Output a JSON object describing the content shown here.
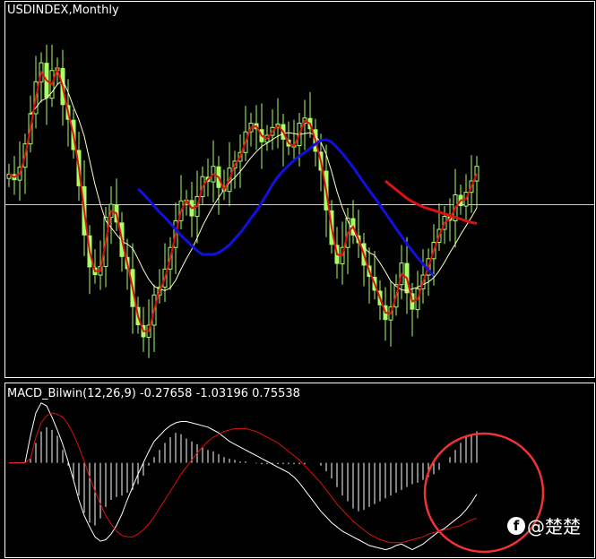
{
  "main_panel": {
    "title": "USDINDEX,Monthly"
  },
  "macd_panel": {
    "title": "MACD_Bilwin(12,26,9) -0.27658 -1.03196 0.75538"
  },
  "watermark": {
    "icon": "facebook-icon",
    "text": "@楚楚"
  },
  "colors": {
    "background": "#000000",
    "frame": "#ffffff",
    "candle": "#aaff66",
    "fast_ma": "#dd1111",
    "slow_ma": "#1111dd",
    "thin_ma": "#ffffcc",
    "macd_line": "#ffffff",
    "signal_line": "#dd1111",
    "annotation_circle": "#ee3333"
  },
  "chart_data": [
    {
      "type": "candlestick",
      "panel": "price",
      "title": "USDINDEX,Monthly",
      "x": [
        0,
        1,
        2,
        3,
        4,
        5,
        6,
        7,
        8,
        9,
        10,
        11,
        12,
        13,
        14,
        15,
        16,
        17,
        18,
        19,
        20,
        21,
        22,
        23,
        24,
        25,
        26,
        27,
        28,
        29,
        30,
        31,
        32,
        33,
        34,
        35,
        36,
        37,
        38,
        39,
        40,
        41,
        42,
        43,
        44,
        45,
        46,
        47,
        48,
        49,
        50,
        51,
        52,
        53,
        54,
        55,
        56,
        57,
        58,
        59,
        60,
        61,
        62,
        63,
        64,
        65,
        66,
        67,
        68,
        69,
        70,
        71,
        72,
        73,
        74,
        75,
        76,
        77,
        78,
        79,
        80,
        81,
        82,
        83,
        84,
        85,
        86,
        87
      ],
      "close": [
        97.9,
        97.2,
        98.7,
        101.4,
        104.9,
        108.6,
        110.8,
        106.7,
        109.9,
        110.2,
        105.9,
        104.2,
        100.7,
        96.5,
        90.8,
        87.1,
        86.2,
        87.2,
        92.9,
        94.4,
        92.3,
        88.3,
        86.9,
        82.5,
        80.4,
        79.0,
        80.4,
        83.9,
        84.8,
        86.9,
        89.4,
        92.5,
        94.8,
        94.9,
        93.0,
        95.3,
        97.6,
        97.0,
        98.8,
        96.3,
        95.9,
        98.6,
        99.4,
        100.4,
        102.8,
        103.8,
        103.1,
        101.6,
        102.4,
        103.3,
        103.7,
        101.9,
        101.1,
        101.2,
        103.8,
        104.4,
        103.1,
        100.5,
        98.3,
        93.7,
        89.7,
        87.5,
        89.4,
        92.8,
        90.8,
        89.9,
        87.3,
        86.0,
        84.4,
        82.7,
        81.0,
        82.5,
        85.1,
        87.6,
        84.1,
        82.2,
        84.6,
        86.2,
        88.1,
        90.0,
        91.5,
        93.0,
        92.5,
        95.5,
        94.2,
        95.8,
        97.1,
        98.8
      ],
      "ylim": [
        75,
        116
      ]
    },
    {
      "type": "line",
      "panel": "price",
      "series": [
        {
          "values": [
            null,
            null,
            null,
            null,
            104.8,
            105.6,
            106.4,
            106.7,
            107.4,
            108.3,
            108.8,
            107.4,
            105.7,
            104.2,
            102.3,
            99.5,
            96.7,
            94.4,
            92.5,
            91.7,
            90.9,
            90.1,
            89.8,
            89.3,
            88.1,
            86.8,
            85.7,
            84.9,
            84.6,
            84.4,
            84.7,
            85.6,
            86.9,
            88.1,
            89.2,
            90.5,
            91.9,
            93.1,
            94.2,
            95.2,
            96.1,
            96.9,
            97.5,
            98.2,
            99.0,
            99.8,
            100.5,
            101.1,
            101.5,
            101.9,
            102.3,
            102.6,
            102.7,
            102.6,
            102.5,
            102.6,
            102.7,
            102.3,
            101.6,
            100.2,
            98.2,
            95.9,
            94.0,
            92.5,
            91.2,
            90.1,
            89.4,
            88.8,
            88.5,
            87.6,
            86.6,
            85.5,
            84.9,
            84.5,
            84.4,
            84.6,
            84.8,
            85.1,
            85.4,
            85.9,
            86.7,
            87.7,
            88.8,
            89.8,
            90.9,
            91.9,
            92.9,
            94.0
          ]
        },
        {
          "values": [
            null,
            null,
            null,
            null,
            null,
            null,
            null,
            null,
            null,
            null,
            null,
            null,
            null,
            null,
            null,
            null,
            null,
            null,
            null,
            null,
            null,
            null,
            null,
            null,
            96.2,
            95.6,
            94.9,
            94.2,
            93.5,
            92.9,
            92.2,
            91.5,
            90.8,
            90.2,
            89.6,
            89.0,
            88.6,
            88.6,
            88.6,
            88.8,
            89.2,
            89.7,
            90.4,
            91.1,
            91.9,
            92.8,
            93.6,
            94.6,
            95.6,
            96.7,
            97.6,
            98.3,
            98.9,
            99.5,
            100.0,
            100.4,
            100.9,
            101.4,
            101.8,
            101.9,
            101.6,
            101.0,
            100.3,
            99.5,
            98.7,
            97.8,
            96.9,
            96.0,
            95.2,
            94.3,
            93.4,
            92.5,
            91.6,
            90.7,
            89.8,
            89.0,
            88.2,
            87.5,
            86.8,
            86.1,
            null,
            null,
            null,
            null,
            null,
            null,
            null,
            null
          ]
        },
        {
          "values": [
            null,
            null,
            null,
            null,
            null,
            null,
            null,
            null,
            null,
            null,
            null,
            null,
            null,
            null,
            null,
            null,
            null,
            null,
            null,
            null,
            null,
            null,
            null,
            null,
            null,
            null,
            null,
            null,
            null,
            null,
            null,
            null,
            null,
            null,
            null,
            null,
            null,
            null,
            null,
            null,
            null,
            null,
            null,
            null,
            null,
            null,
            null,
            null,
            null,
            null,
            null,
            null,
            null,
            null,
            null,
            null,
            null,
            null,
            null,
            null,
            null,
            null,
            null,
            null,
            null,
            null,
            null,
            null,
            null,
            null,
            97.1,
            96.6,
            96.1,
            95.6,
            95.1,
            94.7,
            94.4,
            94.1,
            93.9,
            93.7,
            93.5,
            93.3,
            93.1,
            92.9,
            92.7,
            92.5,
            92.3,
            92.2
          ]
        }
      ]
    },
    {
      "type": "bar",
      "panel": "macd",
      "title": "MACD_Bilwin(12,26,9) -0.27658 -1.03196 0.75538",
      "x": [
        0,
        1,
        2,
        3,
        4,
        5,
        6,
        7,
        8,
        9,
        10,
        11,
        12,
        13,
        14,
        15,
        16,
        17,
        18,
        19,
        20,
        21,
        22,
        23,
        24,
        25,
        26,
        27,
        28,
        29,
        30,
        31,
        32,
        33,
        34,
        35,
        36,
        37,
        38,
        39,
        40,
        41,
        42,
        43,
        44,
        45,
        46,
        47,
        48,
        49,
        50,
        51,
        52,
        53,
        54,
        55,
        56,
        57,
        58,
        59,
        60,
        61,
        62,
        63,
        64,
        65,
        66,
        67,
        68,
        69,
        70,
        71,
        72,
        73,
        74,
        75,
        76,
        77,
        78,
        79,
        80,
        81,
        82,
        83,
        84,
        85,
        86,
        87
      ],
      "values": [
        0,
        0,
        0,
        0,
        0.3,
        1.4,
        2.2,
        2.5,
        2.3,
        1.9,
        0.9,
        -0.2,
        -1.2,
        -2.3,
        -3.5,
        -4.2,
        -4.4,
        -3.9,
        -3.1,
        -2.6,
        -2.4,
        -2.3,
        -2.1,
        -1.9,
        -1.5,
        -0.9,
        -0.2,
        0.4,
        0.9,
        1.4,
        1.8,
        2.1,
        2.0,
        1.7,
        1.5,
        1.3,
        1.1,
        0.9,
        0.8,
        0.6,
        0.4,
        0.3,
        0.2,
        0.1,
        0.1,
        0,
        -0.05,
        -0.1,
        -0.1,
        -0.1,
        -0.1,
        -0.1,
        -0.1,
        -0.1,
        -0.1,
        -0.1,
        0,
        0,
        -0.2,
        -0.6,
        -1.1,
        -1.7,
        -2.3,
        -2.7,
        -3.2,
        -3.4,
        -3.3,
        -3.1,
        -2.9,
        -2.7,
        -2.5,
        -2.3,
        -2.1,
        -1.9,
        -1.7,
        -1.5,
        -1.4,
        -1.2,
        -1.0,
        -0.8,
        -0.5,
        0.0,
        0.4,
        0.9,
        1.4,
        1.8,
        2.0,
        2.2
      ],
      "ylim": [
        -6.5,
        4.5
      ],
      "macd_values": [
        0,
        0,
        0,
        0,
        1.9,
        3.5,
        4.2,
        4.0,
        3.2,
        2.3,
        1.3,
        0.1,
        -1.2,
        -2.6,
        -3.7,
        -4.5,
        -5.2,
        -5.5,
        -5.4,
        -5.0,
        -4.4,
        -3.6,
        -2.6,
        -1.7,
        -0.8,
        0.0,
        0.8,
        1.5,
        1.9,
        2.3,
        2.6,
        2.8,
        2.9,
        2.9,
        2.8,
        2.7,
        2.6,
        2.5,
        2.3,
        2.1,
        1.8,
        1.5,
        1.3,
        1.1,
        0.9,
        0.7,
        0.5,
        0.3,
        0.1,
        -0.1,
        -0.3,
        -0.5,
        -0.7,
        -1.0,
        -1.4,
        -1.9,
        -2.4,
        -2.9,
        -3.4,
        -3.8,
        -4.2,
        -4.5,
        -4.8,
        -5.0,
        -5.2,
        -5.4,
        -5.6,
        -5.8,
        -5.9,
        -6.0,
        -6.1,
        -6.0,
        -5.8,
        -5.7,
        -5.9,
        -6.1,
        -5.9,
        -5.7,
        -5.4,
        -5.1,
        -4.8,
        -4.6,
        -4.3,
        -4.0,
        -3.7,
        -3.3,
        -2.8,
        -2.2
      ],
      "signal_values": [
        0,
        0,
        0,
        0,
        0.3,
        1.8,
        2.8,
        3.3,
        3.5,
        3.4,
        3.2,
        2.7,
        2.0,
        1.1,
        0.1,
        -1.0,
        -2.0,
        -2.9,
        -3.7,
        -4.3,
        -4.8,
        -5.1,
        -5.2,
        -5.2,
        -5.0,
        -4.7,
        -4.3,
        -3.8,
        -3.2,
        -2.6,
        -2.0,
        -1.4,
        -0.8,
        -0.3,
        0.2,
        0.7,
        1.1,
        1.5,
        1.8,
        2.0,
        2.2,
        2.3,
        2.4,
        2.4,
        2.4,
        2.3,
        2.2,
        2.0,
        1.8,
        1.6,
        1.4,
        1.1,
        0.8,
        0.5,
        0.2,
        -0.2,
        -0.6,
        -1.0,
        -1.4,
        -1.9,
        -2.4,
        -2.9,
        -3.3,
        -3.7,
        -4.1,
        -4.4,
        -4.7,
        -5.0,
        -5.2,
        -5.4,
        -5.5,
        -5.6,
        -5.6,
        -5.6,
        -5.5,
        -5.4,
        -5.3,
        -5.2,
        -5.0,
        -4.9,
        -4.8,
        -4.7,
        -4.6,
        -4.5,
        -4.4,
        -4.2,
        -4.0,
        -3.9
      ]
    }
  ]
}
